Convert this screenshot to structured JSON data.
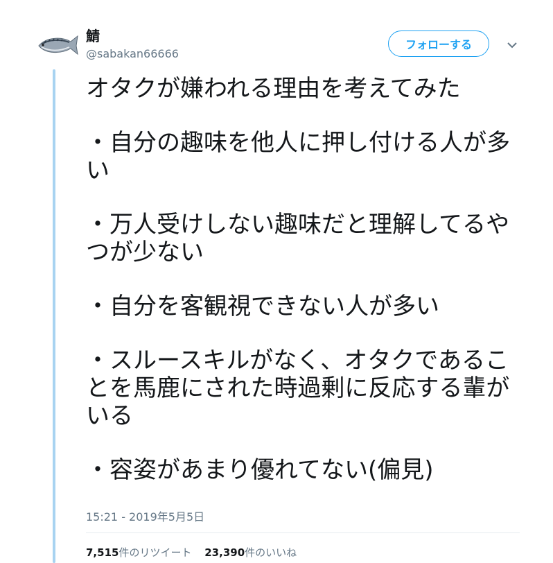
{
  "user": {
    "name": "鯖",
    "handle": "@sabakan66666"
  },
  "follow_button": {
    "label": "フォローする"
  },
  "menu": {
    "icon": "chevron-down-icon"
  },
  "tweet": {
    "lines": [
      "オタクが嫌われる理由を考えてみた",
      "",
      "・自分の趣味を他人に押し付ける人が多",
      "い",
      "",
      "・万人受けしない趣味だと理解してるや",
      "つが少ない",
      "",
      "・自分を客観視できない人が多い",
      "",
      "・スルースキルがなく、オタクであるこ",
      "とを馬鹿にされた時過剰に反応する輩が",
      "いる",
      "",
      "・容姿があまり優れてない(偏見)"
    ]
  },
  "timestamp": "15:21 - 2019年5月5日",
  "stats": {
    "retweets_count": "7,515",
    "retweets_label": "件のリツイート",
    "likes_count": "23,390",
    "likes_label": "件のいいね"
  },
  "colors": {
    "accent": "#1da1f2",
    "thread_line": "#a8d3f1",
    "muted_text": "#657786",
    "text": "#14171a"
  }
}
